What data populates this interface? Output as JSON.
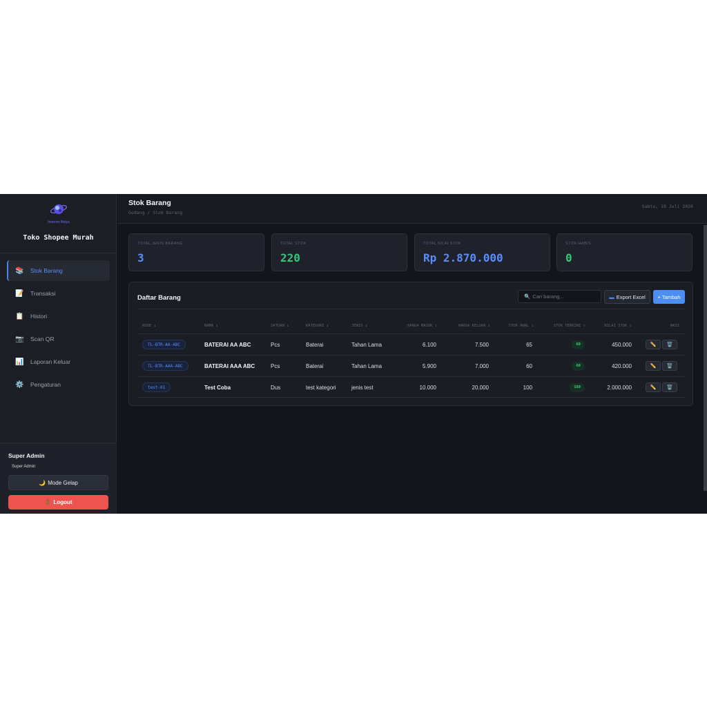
{
  "sidebar": {
    "logo_text": "Internet Mulya",
    "brand_name": "Toko Shopee Murah",
    "items": [
      {
        "icon": "📚",
        "label": "Stok Barang",
        "active": true
      },
      {
        "icon": "📝",
        "label": "Transaksi"
      },
      {
        "icon": "📋",
        "label": "Histori"
      },
      {
        "icon": "📷",
        "label": "Scan QR"
      },
      {
        "icon": "📊",
        "label": "Laporan Keluar"
      },
      {
        "icon": "⚙️",
        "label": "Pengaturan"
      }
    ],
    "user": {
      "name": "Super Admin",
      "role": "Super Admin",
      "dark_mode_icon": "🌙",
      "dark_mode_label": "Mode Gelap",
      "logout_icon": "🚪",
      "logout_label": "Logout"
    }
  },
  "header": {
    "title": "Stok Barang",
    "breadcrumb": "Gudang / Stok Barang",
    "date": "Sabtu, 18 Juli 2026"
  },
  "stats": [
    {
      "label": "TOTAL JENIS BARANG",
      "value": "3",
      "color": "#5b8cf6"
    },
    {
      "label": "TOTAL STOK",
      "value": "220",
      "color": "#34c77b"
    },
    {
      "label": "TOTAL NILAI STOK",
      "value": "Rp 2.870.000",
      "color": "#5b8cf6"
    },
    {
      "label": "STOK HABIS",
      "value": "0",
      "color": "#34c77b"
    }
  ],
  "table": {
    "title": "Daftar Barang",
    "search_placeholder": "Cari barang...",
    "search_icon": "🔍",
    "export_icon": "▬",
    "export_label": "Export Excel",
    "add_label": "+ Tambah",
    "columns": [
      "KODE ↕",
      "NAMA ↕",
      "SATUAN ↕",
      "KATEGORI ↕",
      "JENIS ↕",
      "HARGA MASUK ↕",
      "HARGA KELUAR ↕",
      "STOK AWAL ↕",
      "STOK TERKINI ↕",
      "NILAI STOK ↕",
      "AKSI"
    ],
    "edit_icon": "✏️",
    "delete_icon": "🗑️",
    "rows": [
      {
        "kode": "TL-BTR-AA-ABC",
        "nama": "BATERAI AA ABC",
        "satuan": "Pcs",
        "kategori": "Baterai",
        "jenis": "Tahan Lama",
        "harga_masuk": "6.100",
        "harga_keluar": "7.500",
        "stok_awal": "65",
        "stok_terkini": "60",
        "nilai_stok": "450.000"
      },
      {
        "kode": "TL-BTR-AAA-ABC",
        "nama": "BATERAI AAA ABC",
        "satuan": "Pcs",
        "kategori": "Baterai",
        "jenis": "Tahan Lama",
        "harga_masuk": "5.900",
        "harga_keluar": "7.000",
        "stok_awal": "60",
        "stok_terkini": "60",
        "nilai_stok": "420.000"
      },
      {
        "kode": "test-01",
        "nama": "Test Coba",
        "satuan": "Dus",
        "kategori": "test kategori",
        "jenis": "jenis test",
        "harga_masuk": "10.000",
        "harga_keluar": "20.000",
        "stok_awal": "100",
        "stok_terkini": "100",
        "nilai_stok": "2.000.000"
      }
    ]
  }
}
